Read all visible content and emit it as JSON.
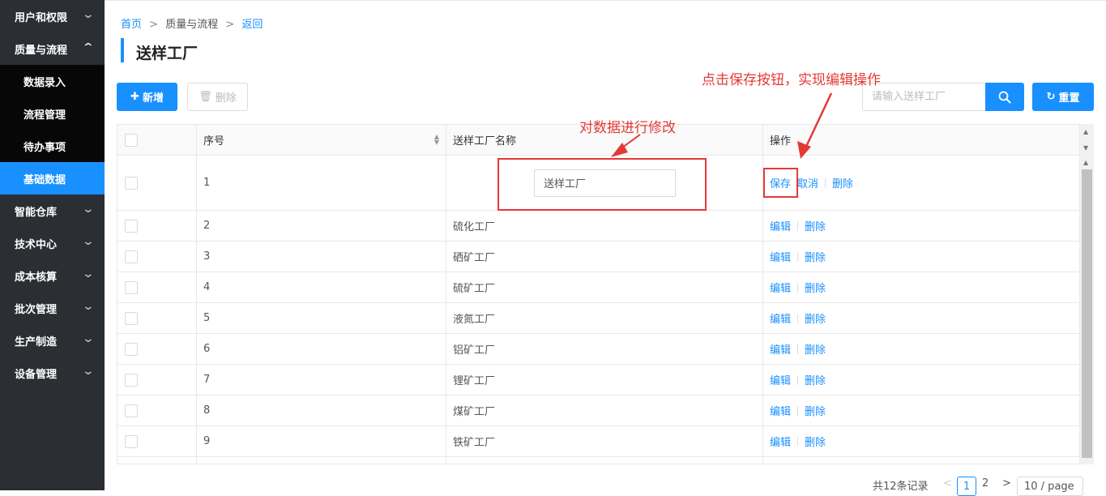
{
  "sidebar": {
    "items": [
      {
        "label": "用户和权限",
        "chevron": "down"
      },
      {
        "label": "质量与流程",
        "chevron": "up"
      },
      {
        "label": "数据录入",
        "sub": true
      },
      {
        "label": "流程管理",
        "sub": true
      },
      {
        "label": "待办事项",
        "sub": true
      },
      {
        "label": "基础数据",
        "sub": true,
        "active": true
      },
      {
        "label": "智能仓库",
        "chevron": "down"
      },
      {
        "label": "技术中心",
        "chevron": "down"
      },
      {
        "label": "成本核算",
        "chevron": "down"
      },
      {
        "label": "批次管理",
        "chevron": "down"
      },
      {
        "label": "生产制造",
        "chevron": "down"
      },
      {
        "label": "设备管理",
        "chevron": "down"
      }
    ]
  },
  "breadcrumb": {
    "home": "首页",
    "sep": ">",
    "current": "质量与流程",
    "back": "返回"
  },
  "page_title": "送样工厂",
  "toolbar": {
    "add_label": "新增",
    "delete_label": "删除",
    "reset_label": "重置",
    "search_placeholder": "请输入送样工厂"
  },
  "table": {
    "headers": {
      "index": "序号",
      "name": "送样工厂名称",
      "actions": "操作"
    },
    "edit_row": {
      "index": "1",
      "value": "送样工厂",
      "save": "保存",
      "cancel": "取消",
      "delete": "删除"
    },
    "rows": [
      {
        "index": "2",
        "name": "硫化工厂"
      },
      {
        "index": "3",
        "name": "硒矿工厂"
      },
      {
        "index": "4",
        "name": "硫矿工厂"
      },
      {
        "index": "5",
        "name": "液氮工厂"
      },
      {
        "index": "6",
        "name": "铝矿工厂"
      },
      {
        "index": "7",
        "name": "锂矿工厂"
      },
      {
        "index": "8",
        "name": "煤矿工厂"
      },
      {
        "index": "9",
        "name": "铁矿工厂"
      }
    ],
    "edit_label": "编辑",
    "delete_label": "删除"
  },
  "pagination": {
    "total": "共12条记录",
    "prev": "<",
    "page1": "1",
    "page2": "2",
    "next": ">",
    "page_size": "10 / page"
  },
  "annotations": {
    "modify": "对数据进行修改",
    "save_hint": "点击保存按钮，实现编辑操作"
  },
  "colors": {
    "accent": "#1890ff",
    "sidebar_bg": "#2b2e33",
    "submenu_bg": "#070707",
    "annotation": "#e53935"
  },
  "icons": {
    "add": "plus-icon",
    "delete": "trash-icon",
    "search": "search-icon",
    "reset": "refresh-icon",
    "expand": "chevron-down-icon",
    "collapse": "chevron-up-icon",
    "sort": "sort-icon"
  }
}
